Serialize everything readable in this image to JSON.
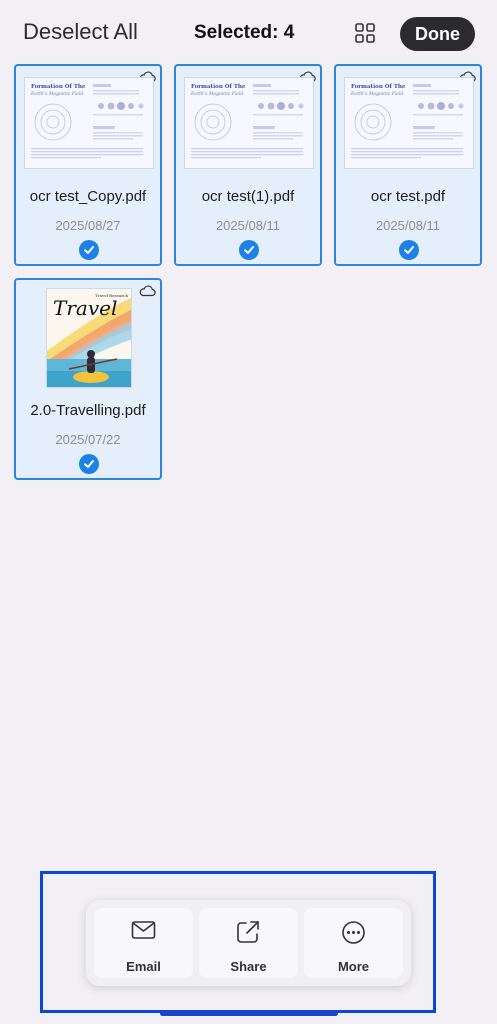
{
  "header": {
    "deselect_label": "Deselect All",
    "title": "Selected: 4",
    "done_label": "Done"
  },
  "files": [
    {
      "name": "ocr test_Copy.pdf",
      "date": "2025/08/27",
      "thumb_title": "Formation Of The",
      "thumb_subtitle": "Earth's Magnetic Field"
    },
    {
      "name": "ocr test(1).pdf",
      "date": "2025/08/11",
      "thumb_title": "Formation Of The",
      "thumb_subtitle": "Earth's Magnetic Field"
    },
    {
      "name": "ocr test.pdf",
      "date": "2025/08/11",
      "thumb_title": "Formation Of The",
      "thumb_subtitle": "Earth's Magnetic Field"
    },
    {
      "name": "2.0-Travelling.pdf",
      "date": "2025/07/22",
      "thumb_title": "Travel",
      "thumb_subtitle": "Travel Research"
    }
  ],
  "actions": [
    {
      "label": "Email",
      "icon": "mail-icon"
    },
    {
      "label": "Share",
      "icon": "share-icon"
    },
    {
      "label": "More",
      "icon": "more-icon"
    }
  ],
  "colors": {
    "accent": "#1d82e6",
    "card_bg": "#e4effb",
    "done_bg": "#2b2b2d",
    "highlight": "#0a47d8"
  }
}
